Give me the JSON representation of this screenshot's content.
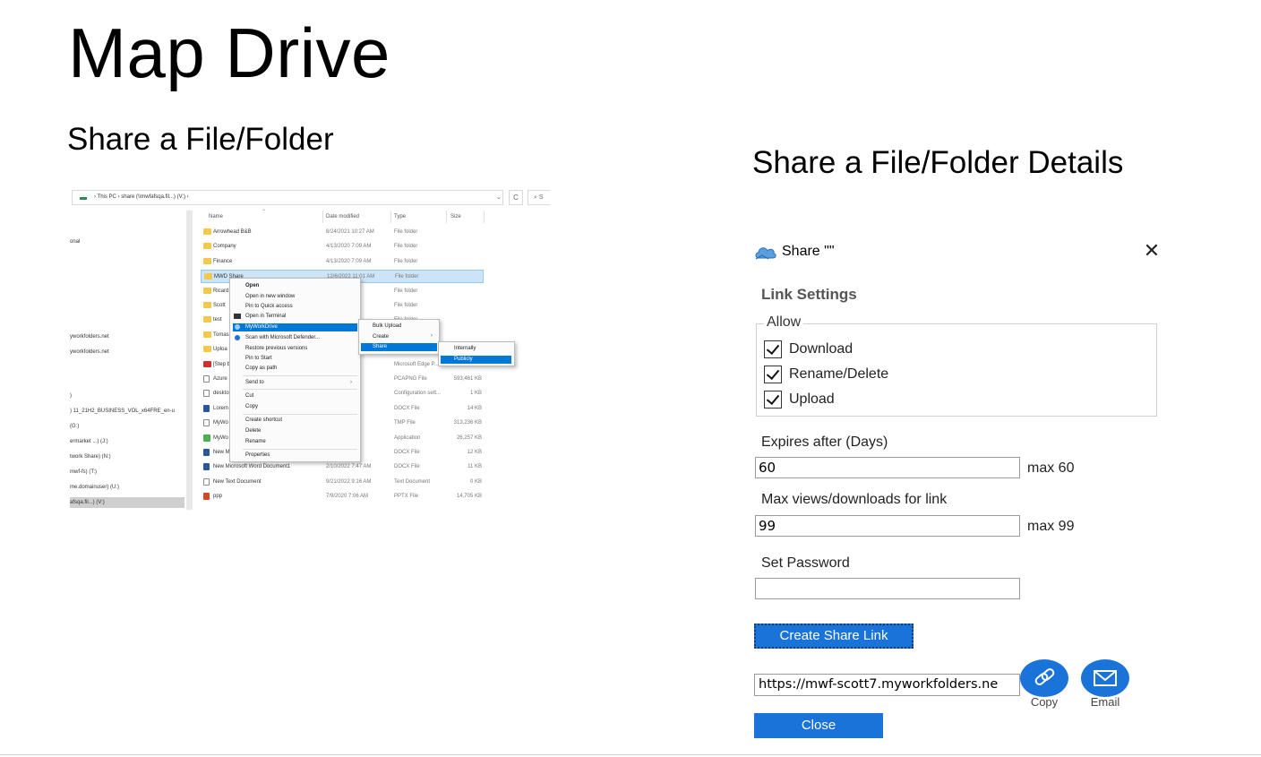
{
  "slide": {
    "title": "Map Drive",
    "left_heading": "Share a File/Folder",
    "right_heading": "Share a File/Folder Details"
  },
  "explorer": {
    "breadcrumb": "›  This PC  ›  share (\\\\mwfafsqa.fil...) (V:)  ›",
    "refresh_glyph": "C",
    "search_glyph": "⌕ S",
    "nav_items": [
      {
        "label": "onal"
      },
      {
        "label": "yworkfolders.net"
      },
      {
        "label": "yworkfolders.net"
      },
      {
        "label": ")"
      },
      {
        "label": ") 11_21H2_BUSINESS_VOL_x64FRE_en-u"
      },
      {
        "label": "(G:)"
      },
      {
        "label": "ermarket ...) (J:)"
      },
      {
        "label": "twork Share) (N:)"
      },
      {
        "label": "mwf-fs) (T:)"
      },
      {
        "label": "me.domainuser) (U:)"
      },
      {
        "label": "afsqa.fil...) (V:)"
      }
    ],
    "columns": {
      "name": "Name",
      "date": "Date modified",
      "type": "Type",
      "size": "Size"
    },
    "files": [
      {
        "name": "Arrowhead B&B",
        "date": "8/24/2021 10:27 AM",
        "type": "File folder",
        "size": "",
        "icon": "folder-icon"
      },
      {
        "name": "Company",
        "date": "4/13/2020 7:09 AM",
        "type": "File folder",
        "size": "",
        "icon": "folder-icon"
      },
      {
        "name": "Finance",
        "date": "4/13/2020 7:09 AM",
        "type": "File folder",
        "size": "",
        "icon": "folder-icon"
      },
      {
        "name": "MWD Share",
        "date": "12/6/2022 11:01 AM",
        "type": "File folder",
        "size": "",
        "icon": "folder-icon"
      },
      {
        "name": "Ricard",
        "date": "3 PM",
        "type": "File folder",
        "size": "",
        "icon": "folder-icon"
      },
      {
        "name": "Scott",
        "date": "3 AM",
        "type": "File folder",
        "size": "",
        "icon": "folder-icon"
      },
      {
        "name": "test",
        "date": "3 PM",
        "type": "File folder",
        "size": "",
        "icon": "folder-icon"
      },
      {
        "name": "Tomas",
        "date": "",
        "type": "",
        "size": "",
        "icon": "folder-icon"
      },
      {
        "name": "Uploa",
        "date": "",
        "type": "",
        "size": "",
        "icon": "folder-icon"
      },
      {
        "name": "[Step b",
        "date": "8 PM",
        "type": "Microsoft Edge P...",
        "size": "",
        "icon": "pdf-icon"
      },
      {
        "name": "Azure",
        "date": "9 PM",
        "type": "PCAPNG File",
        "size": "593,461 KB",
        "icon": "txt-icon"
      },
      {
        "name": "deskto",
        "date": "7 PM",
        "type": "Configuration sett...",
        "size": "1 KB",
        "icon": "txt-icon"
      },
      {
        "name": "Lorem",
        "date": "6 AM",
        "type": "DOCX File",
        "size": "14 KB",
        "icon": "doc-icon"
      },
      {
        "name": "MyWo",
        "date": "7 AM",
        "type": "TMP File",
        "size": "313,236 KB",
        "icon": "txt-icon"
      },
      {
        "name": "MyWo",
        "date": "5 AM",
        "type": "Application",
        "size": "26,257 KB",
        "icon": "app-icon"
      },
      {
        "name": "New M",
        "date": "0 PM",
        "type": "DOCX File",
        "size": "12 KB",
        "icon": "doc-icon"
      },
      {
        "name": "New Microsoft Word Document1",
        "date": "2/10/2022 7:47 AM",
        "type": "DOCX File",
        "size": "11 KB",
        "icon": "doc-icon"
      },
      {
        "name": "New Text Document",
        "date": "9/21/2022 9:16 AM",
        "type": "Text Document",
        "size": "0 KB",
        "icon": "txt-icon"
      },
      {
        "name": "ppp",
        "date": "7/9/2020 7:06 AM",
        "type": "PPTX File",
        "size": "14,705 KB",
        "icon": "ppt-icon"
      }
    ],
    "context_menu": {
      "open": "Open",
      "open_new_window": "Open in new window",
      "pin_quick_access": "Pin to Quick access",
      "open_terminal": "Open in Terminal",
      "myworkdrive": "MyWorkDrive",
      "scan_defender": "Scan with Microsoft Defender...",
      "restore_versions": "Restore previous versions",
      "pin_start": "Pin to Start",
      "copy_as_path": "Copy as path",
      "send_to": "Send to",
      "cut": "Cut",
      "copy": "Copy",
      "create_shortcut": "Create shortcut",
      "delete": "Delete",
      "rename": "Rename",
      "properties": "Properties"
    },
    "submenu": {
      "bulk_upload": "Bulk Upload",
      "create": "Create",
      "share": "Share"
    },
    "share_submenu": {
      "internally": "Internally",
      "publicly": "Publicly"
    }
  },
  "dialog": {
    "title": "Share \"\"",
    "close_glyph": "✕",
    "section_title": "Link Settings",
    "allow_legend": "Allow",
    "permissions": [
      {
        "label": "Download",
        "checked": true
      },
      {
        "label": "Rename/Delete",
        "checked": true
      },
      {
        "label": "Upload",
        "checked": true
      }
    ],
    "expires_label": "Expires after (Days)",
    "expires_value": "60",
    "expires_max": "max 60",
    "max_views_label": "Max views/downloads for link",
    "max_views_value": "99",
    "max_views_max": "max 99",
    "password_label": "Set Password",
    "password_value": "",
    "create_button": "Create Share Link",
    "share_link": "https://mwf-scott7.myworkfolders.ne",
    "copy_label": "Copy",
    "email_label": "Email",
    "close_button": "Close"
  },
  "colors": {
    "accent": "#1a73d9",
    "selection": "#0078d7",
    "row_selection": "#cce4f7"
  }
}
